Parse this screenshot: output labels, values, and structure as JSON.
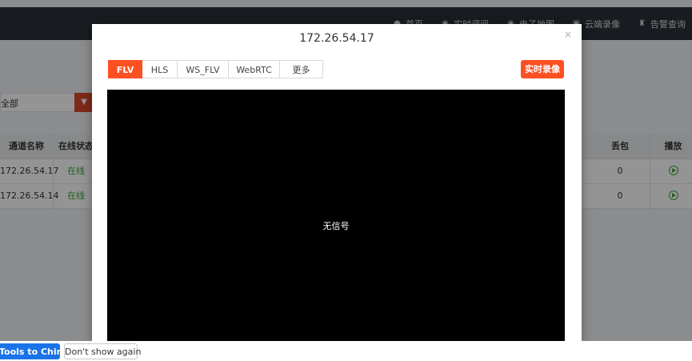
{
  "topnav": {
    "items": [
      {
        "label": "首页",
        "icon": "home-icon"
      },
      {
        "label": "实时调阅",
        "icon": "live-icon"
      },
      {
        "label": "电子地图",
        "icon": "map-icon"
      },
      {
        "label": "云端录像",
        "icon": "cloud-record-icon"
      },
      {
        "label": "告警查询",
        "icon": "alarm-icon"
      }
    ]
  },
  "filter": {
    "select_value": "全部"
  },
  "table": {
    "headers": {
      "name": "通道名称",
      "status": "在线状态",
      "loss": "丢包",
      "play": "播放"
    },
    "rows": [
      {
        "name": "172.26.54.17",
        "status": "在线",
        "loss": "0"
      },
      {
        "name": "172.26.54.14",
        "status": "在线",
        "loss": "0"
      }
    ]
  },
  "modal": {
    "title": "172.26.54.17",
    "close": "×",
    "tabs": [
      "FLV",
      "HLS",
      "WS_FLV",
      "WebRTC",
      "更多"
    ],
    "active_tab": "FLV",
    "record_button": "实时录像",
    "video_text": "无信号"
  },
  "translate_bar": {
    "primary": "Tools to Chinese",
    "secondary": "Don't show again"
  },
  "colors": {
    "accent": "#fb5022",
    "topbar": "#2a2f36",
    "online": "#3aa53a",
    "translate_blue": "#1a73e8"
  }
}
